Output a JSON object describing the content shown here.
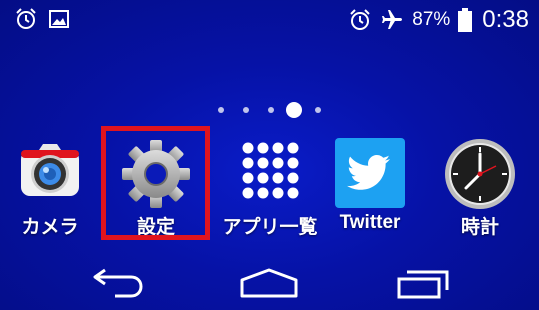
{
  "status_bar": {
    "left_icons": [
      "alarm-icon",
      "image-notification-icon"
    ],
    "right_icons": [
      "alarm-icon",
      "airplane-mode-icon",
      "battery-icon"
    ],
    "battery_percent": "87%",
    "time": "0:38"
  },
  "home": {
    "page_count": 5,
    "active_page": 4,
    "apps": [
      {
        "label": "カメラ",
        "icon": "camera-icon"
      },
      {
        "label": "設定",
        "icon": "gear-icon",
        "highlighted": true
      },
      {
        "label": "アプリ一覧",
        "icon": "app-drawer-icon"
      },
      {
        "label": "Twitter",
        "icon": "twitter-bird-icon"
      },
      {
        "label": "時計",
        "icon": "clock-icon"
      }
    ]
  },
  "nav_bar": {
    "buttons": [
      "back-icon",
      "home-icon",
      "recent-apps-icon"
    ]
  },
  "colors": {
    "background": "#0612a6",
    "highlight": "#e0141e",
    "twitter_blue": "#1da1f2"
  }
}
